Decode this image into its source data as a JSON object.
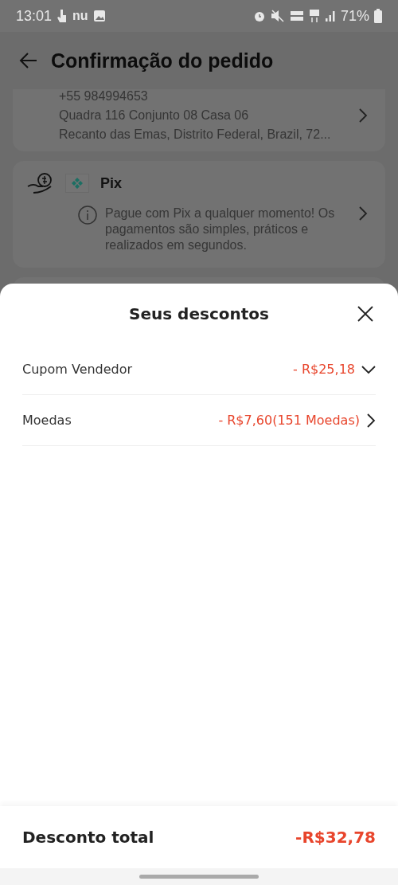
{
  "status_bar": {
    "time": "13:01",
    "notification_logo": "nu",
    "battery": "71%"
  },
  "header": {
    "title": "Confirmação do pedido"
  },
  "address": {
    "phone": "+55 984994653",
    "lines": [
      "Quadra 116 Conjunto 08 Casa 06",
      "Recanto das Emas, Distrito Federal, Brazil, 72..."
    ]
  },
  "payment": {
    "method": "Pix",
    "note": "Pague com Pix a qualquer momento! Os pagamentos são simples, práticos e realizados em segundos."
  },
  "sheet": {
    "title": "Seus descontos",
    "rows": [
      {
        "label": "Cupom Vendedor",
        "amount": "- R$25,18",
        "kind": "dropdown"
      },
      {
        "label": "Moedas",
        "amount": "- R$7,60(151 Moedas)",
        "kind": "link"
      }
    ],
    "total": {
      "label": "Desconto total",
      "amount": "-R$32,78"
    }
  }
}
